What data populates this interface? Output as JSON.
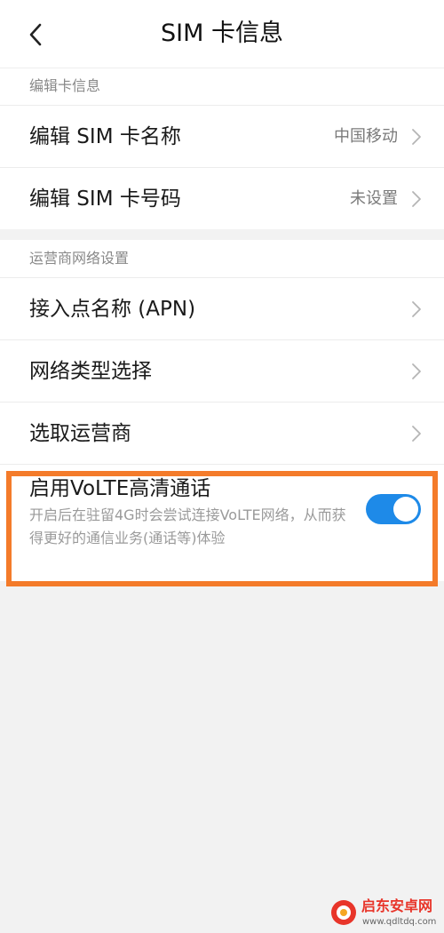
{
  "header": {
    "title": "SIM  卡信息",
    "back_icon": "chevron-left-icon"
  },
  "sections": [
    {
      "header": "编辑卡信息",
      "items": [
        {
          "label": "编辑 SIM 卡名称",
          "value": "中国移动"
        },
        {
          "label": "编辑 SIM 卡号码",
          "value": "未设置"
        }
      ]
    },
    {
      "header": "运营商网络设置",
      "items": [
        {
          "label": "接入点名称 (APN)"
        },
        {
          "label": "网络类型选择"
        },
        {
          "label": "选取运营商"
        }
      ]
    }
  ],
  "volte": {
    "title": "启用VoLTE高清通话",
    "description": "开启后在驻留4G时会尝试连接VoLTE网络，从而获得更好的通信业务(通话等)体验",
    "enabled": true
  },
  "colors": {
    "toggle_on": "#1e8ae8",
    "highlight": "#f47b2a",
    "page_background": "#f2f2f2"
  },
  "watermark": {
    "name": "启东安卓网",
    "url": "www.qdltdq.com"
  }
}
